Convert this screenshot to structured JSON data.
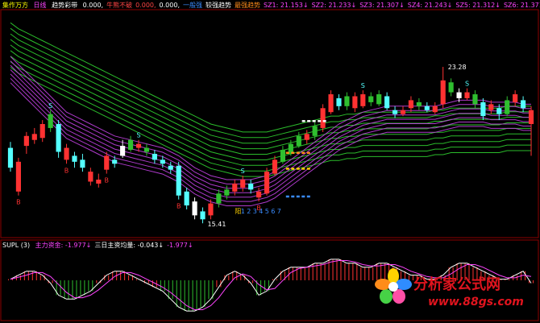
{
  "header": {
    "title": "集作万方",
    "period": "日线",
    "indicator_name": "趋势彩带",
    "items": [
      {
        "label": "0.000,",
        "color": "#ffffff"
      },
      {
        "label": "牛熊不破",
        "color": "#ff4444"
      },
      {
        "label": "0.000,",
        "color": "#ff4444"
      },
      {
        "label": "0.000,",
        "color": "#ffffff"
      },
      {
        "label": "一般强",
        "color": "#3a8cff"
      },
      {
        "label": "较强趋势",
        "color": "#ffffff"
      },
      {
        "label": "最强趋势",
        "color": "#ff8c1a"
      },
      {
        "label": "SZ1: 21.153↓",
        "color": "#ff44ff"
      },
      {
        "label": "SZ2: 21.233↓",
        "color": "#ff44ff"
      },
      {
        "label": "SZ3: 21.307↓",
        "color": "#ff44ff"
      },
      {
        "label": "SZ4: 21.243↓",
        "color": "#ff44ff"
      },
      {
        "label": "SZ5: 21.312↓",
        "color": "#ff44ff"
      },
      {
        "label": "SZ6: 21.371↓",
        "color": "#ff44ff"
      }
    ]
  },
  "sub_header": {
    "name": "SUPL (3)",
    "items": [
      {
        "label": "主力资金: -1.977↓",
        "color": "#ff44ff"
      },
      {
        "label": "三日主资均量: -0.043↓",
        "color": "#ffffff"
      },
      {
        "label": "-1.977↓",
        "color": "#ff44ff"
      }
    ]
  },
  "watermark": {
    "text": "分析家公式网",
    "url": "www.88gs.com"
  },
  "colors": {
    "up": "#ff3232",
    "down": "#54ffff",
    "green_candle": "#2fbf2f",
    "white_candle": "#ffffff",
    "ribbon_green": "#33dd33",
    "ribbon_purple": "#c040e0",
    "frame": "#8b0000"
  },
  "chart_data": {
    "type": "candlestick",
    "max_price_label": "23.28",
    "min_price_label": "15.41",
    "count_labels": [
      "阳",
      "1",
      "2",
      "3",
      "4",
      "5",
      "6",
      "7"
    ],
    "signals": {
      "buy": "B",
      "sell": "S"
    },
    "candles": [
      {
        "o": 19.2,
        "c": 18.2,
        "h": 19.5,
        "l": 18.0,
        "col": "down"
      },
      {
        "o": 18.5,
        "c": 17.0,
        "h": 18.7,
        "l": 16.8,
        "col": "up"
      },
      {
        "o": 19.3,
        "c": 19.8,
        "h": 20.0,
        "l": 18.9,
        "col": "up"
      },
      {
        "o": 19.6,
        "c": 19.9,
        "h": 20.2,
        "l": 19.4,
        "col": "up"
      },
      {
        "o": 19.7,
        "c": 20.4,
        "h": 20.6,
        "l": 19.5,
        "col": "up"
      },
      {
        "o": 20.2,
        "c": 20.9,
        "h": 21.1,
        "l": 20.0,
        "col": "green_candle"
      },
      {
        "o": 20.4,
        "c": 19.0,
        "h": 20.6,
        "l": 18.7,
        "col": "down"
      },
      {
        "o": 19.2,
        "c": 18.6,
        "h": 19.4,
        "l": 18.4,
        "col": "up"
      },
      {
        "o": 18.8,
        "c": 18.5,
        "h": 19.0,
        "l": 18.2,
        "col": "down"
      },
      {
        "o": 18.6,
        "c": 18.2,
        "h": 18.9,
        "l": 18.0,
        "col": "down"
      },
      {
        "o": 18.0,
        "c": 17.5,
        "h": 18.2,
        "l": 17.3,
        "col": "up"
      },
      {
        "o": 17.6,
        "c": 17.4,
        "h": 17.9,
        "l": 17.2,
        "col": "up"
      },
      {
        "o": 18.1,
        "c": 18.8,
        "h": 19.0,
        "l": 17.9,
        "col": "up"
      },
      {
        "o": 18.6,
        "c": 18.4,
        "h": 18.8,
        "l": 18.2,
        "col": "down"
      },
      {
        "o": 18.8,
        "c": 19.3,
        "h": 19.6,
        "l": 18.7,
        "col": "white_candle"
      },
      {
        "o": 19.1,
        "c": 19.6,
        "h": 19.8,
        "l": 19.0,
        "col": "green_candle"
      },
      {
        "o": 19.4,
        "c": 19.2,
        "h": 19.6,
        "l": 19.0,
        "col": "up"
      },
      {
        "o": 19.2,
        "c": 19.0,
        "h": 19.4,
        "l": 18.8,
        "col": "green_candle"
      },
      {
        "o": 18.9,
        "c": 18.6,
        "h": 19.1,
        "l": 18.4,
        "col": "down"
      },
      {
        "o": 18.6,
        "c": 18.4,
        "h": 18.8,
        "l": 18.2,
        "col": "down"
      },
      {
        "o": 18.3,
        "c": 18.1,
        "h": 18.5,
        "l": 17.9,
        "col": "down"
      },
      {
        "o": 18.3,
        "c": 16.8,
        "h": 18.5,
        "l": 16.6,
        "col": "down"
      },
      {
        "o": 17.0,
        "c": 16.3,
        "h": 17.2,
        "l": 16.1,
        "col": "down"
      },
      {
        "o": 16.5,
        "c": 15.8,
        "h": 16.7,
        "l": 15.6,
        "col": "white_candle"
      },
      {
        "o": 16.0,
        "c": 15.6,
        "h": 16.2,
        "l": 15.4,
        "col": "down"
      },
      {
        "o": 15.8,
        "c": 16.4,
        "h": 16.6,
        "l": 15.6,
        "col": "up"
      },
      {
        "o": 16.4,
        "c": 16.9,
        "h": 17.1,
        "l": 16.2,
        "col": "green_candle"
      },
      {
        "o": 16.8,
        "c": 17.1,
        "h": 17.3,
        "l": 16.6,
        "col": "green_candle"
      },
      {
        "o": 17.0,
        "c": 17.4,
        "h": 17.6,
        "l": 16.8,
        "col": "up"
      },
      {
        "o": 17.2,
        "c": 17.6,
        "h": 17.8,
        "l": 17.0,
        "col": "up"
      },
      {
        "o": 17.4,
        "c": 17.1,
        "h": 17.6,
        "l": 16.9,
        "col": "down"
      },
      {
        "o": 17.0,
        "c": 16.7,
        "h": 17.2,
        "l": 16.5,
        "col": "up"
      },
      {
        "o": 16.9,
        "c": 18.0,
        "h": 18.2,
        "l": 16.8,
        "col": "up"
      },
      {
        "o": 17.9,
        "c": 18.6,
        "h": 18.8,
        "l": 17.8,
        "col": "up"
      },
      {
        "o": 18.5,
        "c": 19.1,
        "h": 19.3,
        "l": 18.4,
        "col": "green_candle"
      },
      {
        "o": 18.9,
        "c": 19.4,
        "h": 19.6,
        "l": 18.8,
        "col": "green_candle"
      },
      {
        "o": 19.3,
        "c": 19.8,
        "h": 20.0,
        "l": 19.2,
        "col": "green_candle"
      },
      {
        "o": 19.6,
        "c": 19.9,
        "h": 20.1,
        "l": 19.4,
        "col": "up"
      },
      {
        "o": 19.8,
        "c": 20.3,
        "h": 20.5,
        "l": 19.6,
        "col": "green_candle"
      },
      {
        "o": 20.2,
        "c": 21.2,
        "h": 21.4,
        "l": 20.0,
        "col": "up"
      },
      {
        "o": 21.0,
        "c": 21.9,
        "h": 22.1,
        "l": 20.9,
        "col": "up"
      },
      {
        "o": 21.7,
        "c": 21.3,
        "h": 21.9,
        "l": 21.1,
        "col": "down"
      },
      {
        "o": 21.3,
        "c": 21.8,
        "h": 22.0,
        "l": 21.1,
        "col": "green_candle"
      },
      {
        "o": 21.8,
        "c": 21.2,
        "h": 22.0,
        "l": 21.0,
        "col": "up"
      },
      {
        "o": 21.3,
        "c": 21.9,
        "h": 22.1,
        "l": 21.2,
        "col": "up"
      },
      {
        "o": 21.8,
        "c": 21.5,
        "h": 22.0,
        "l": 21.3,
        "col": "green_candle"
      },
      {
        "o": 21.4,
        "c": 21.9,
        "h": 22.1,
        "l": 21.3,
        "col": "green_candle"
      },
      {
        "o": 21.8,
        "c": 21.2,
        "h": 22.0,
        "l": 21.1,
        "col": "down"
      },
      {
        "o": 21.1,
        "c": 20.9,
        "h": 21.3,
        "l": 20.7,
        "col": "down"
      },
      {
        "o": 20.9,
        "c": 21.1,
        "h": 21.3,
        "l": 20.8,
        "col": "up"
      },
      {
        "o": 21.2,
        "c": 21.6,
        "h": 21.8,
        "l": 21.0,
        "col": "up"
      },
      {
        "o": 21.5,
        "c": 21.3,
        "h": 21.7,
        "l": 21.1,
        "col": "green_candle"
      },
      {
        "o": 21.3,
        "c": 21.1,
        "h": 21.5,
        "l": 21.0,
        "col": "down"
      },
      {
        "o": 21.0,
        "c": 21.3,
        "h": 21.5,
        "l": 20.9,
        "col": "up"
      },
      {
        "o": 21.4,
        "c": 22.6,
        "h": 23.28,
        "l": 21.2,
        "col": "up"
      },
      {
        "o": 22.5,
        "c": 22.0,
        "h": 22.7,
        "l": 21.8,
        "col": "green_candle"
      },
      {
        "o": 22.0,
        "c": 21.7,
        "h": 22.2,
        "l": 21.5,
        "col": "white_candle"
      },
      {
        "o": 21.7,
        "c": 22.0,
        "h": 22.2,
        "l": 21.6,
        "col": "up"
      },
      {
        "o": 21.9,
        "c": 21.4,
        "h": 22.1,
        "l": 21.2,
        "col": "green_candle"
      },
      {
        "o": 21.5,
        "c": 20.8,
        "h": 21.7,
        "l": 20.6,
        "col": "down"
      },
      {
        "o": 21.1,
        "c": 21.4,
        "h": 21.6,
        "l": 20.9,
        "col": "up"
      },
      {
        "o": 21.2,
        "c": 20.9,
        "h": 21.4,
        "l": 20.6,
        "col": "down"
      },
      {
        "o": 20.9,
        "c": 21.6,
        "h": 21.8,
        "l": 20.8,
        "col": "green_candle"
      },
      {
        "o": 21.5,
        "c": 21.9,
        "h": 22.1,
        "l": 21.3,
        "col": "up"
      },
      {
        "o": 21.6,
        "c": 21.2,
        "h": 21.8,
        "l": 21.0,
        "col": "down"
      },
      {
        "o": 21.1,
        "c": 20.4,
        "h": 21.3,
        "l": 18.8,
        "col": "up"
      }
    ],
    "ribbon": {
      "green_top": [
        25.5,
        25.2,
        25.0,
        24.8,
        24.6,
        24.4,
        24.2,
        24.0,
        23.8,
        23.6,
        23.4,
        23.2,
        23.0,
        22.8,
        22.6,
        22.4,
        22.2,
        22.0,
        21.8,
        21.6,
        21.4,
        21.2,
        21.0,
        20.8,
        20.6,
        20.4,
        20.3,
        20.2,
        20.1,
        20.0,
        20.0,
        20.0,
        20.0,
        20.1,
        20.2,
        20.3,
        20.4,
        20.5,
        20.6,
        20.7,
        20.8,
        20.8,
        20.9,
        20.9,
        21.0,
        21.0,
        21.0,
        21.0,
        21.0,
        21.0,
        21.0,
        21.0,
        21.0,
        21.1,
        21.1,
        21.2,
        21.2,
        21.2,
        21.2,
        21.2,
        21.2,
        21.2,
        21.3,
        21.3,
        21.3,
        21.3
      ],
      "purple_top": [
        23.8,
        23.4,
        23.0,
        22.6,
        22.2,
        21.8,
        21.4,
        21.0,
        20.8,
        20.6,
        20.4,
        20.2,
        20.0,
        19.8,
        19.7,
        19.6,
        19.5,
        19.4,
        19.3,
        19.2,
        19.0,
        18.8,
        18.5,
        18.2,
        18.0,
        17.8,
        17.7,
        17.6,
        17.6,
        17.6,
        17.6,
        17.7,
        17.8,
        18.0,
        18.3,
        18.6,
        18.9,
        19.2,
        19.5,
        19.8,
        20.1,
        20.4,
        20.6,
        20.8,
        21.0,
        21.1,
        21.2,
        21.3,
        21.3,
        21.3,
        21.3,
        21.3,
        21.3,
        21.3,
        21.4,
        21.5,
        21.6,
        21.6,
        21.6,
        21.6,
        21.5,
        21.5,
        21.5,
        21.5,
        21.4,
        21.4
      ]
    },
    "oscillator": {
      "values": [
        2,
        3,
        4,
        4,
        3,
        1,
        -2,
        -3,
        -3,
        -2,
        -1,
        1,
        3,
        4,
        4,
        3,
        2,
        1,
        0,
        -1,
        -3,
        -5,
        -6,
        -6,
        -5,
        -3,
        0,
        3,
        4,
        3,
        1,
        -2,
        -1,
        2,
        4,
        5,
        5,
        5,
        6,
        6,
        7,
        7,
        6,
        6,
        5,
        5,
        6,
        6,
        5,
        4,
        3,
        3,
        2,
        2,
        3,
        5,
        6,
        6,
        5,
        4,
        3,
        2,
        2,
        3,
        4,
        1
      ],
      "ylim": [
        -8,
        9
      ]
    }
  }
}
